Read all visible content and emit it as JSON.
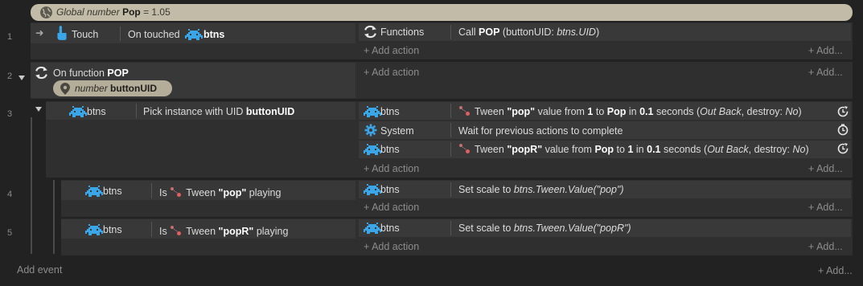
{
  "global_var": {
    "prefix": "Global number",
    "name": "Pop",
    "value_text": "= 1.05"
  },
  "rows": [
    {
      "num": "1",
      "cond_object": "Touch",
      "cond_text_pre": "On touched",
      "cond_obj2": "btns",
      "act_object": "Functions",
      "act_text_pre": "Call",
      "act_bold": "POP",
      "act_text_post": "(buttonUID:",
      "act_italic": "btns.UID",
      "act_close": ")",
      "add_action": "Add action",
      "add_more": "Add..."
    },
    {
      "num": "2",
      "cond_text_pre": "On function",
      "cond_bold": "POP",
      "param_italic": "number",
      "param_name": "buttonUID",
      "add_action": "Add action",
      "add_more": "Add..."
    },
    {
      "num": "3",
      "cond_object": "btns",
      "cond_text_pre": "Pick instance with UID",
      "cond_bold": "buttonUID",
      "actions": [
        {
          "object": "btns",
          "t1": "Tween",
          "b1": "\"pop\"",
          "t2": "value from",
          "b2": "1",
          "t3": "to",
          "b3": "Pop",
          "t4": "in",
          "b4": "0.1",
          "t5": "seconds (",
          "i1": "Out Back",
          "t6": ", destroy:",
          "i2": "No",
          "t7": ")"
        },
        {
          "object": "System",
          "text": "Wait for previous actions to complete"
        },
        {
          "object": "btns",
          "t1": "Tween",
          "b1": "\"popR\"",
          "t2": "value from",
          "b2": "Pop",
          "t3": "to",
          "b3": "1",
          "t4": "in",
          "b4": "0.1",
          "t5": "seconds (",
          "i1": "Out Back",
          "t6": ", destroy:",
          "i2": "No",
          "t7": ")"
        }
      ],
      "add_action": "Add action",
      "add_more": "Add..."
    },
    {
      "num": "4",
      "cond_object": "btns",
      "cond_text_pre": "Is",
      "cond_text_mid": "Tween",
      "cond_bold": "\"pop\"",
      "cond_text_post": "playing",
      "act_object": "btns",
      "act_text": "Set scale to",
      "act_italic": "btns.Tween.Value(\"pop\")",
      "add_action": "Add action",
      "add_more": "Add..."
    },
    {
      "num": "5",
      "cond_object": "btns",
      "cond_text_pre": "Is",
      "cond_text_mid": "Tween",
      "cond_bold": "\"popR\"",
      "cond_text_post": "playing",
      "act_object": "btns",
      "act_text": "Set scale to",
      "act_italic": "btns.Tween.Value(\"popR\")",
      "add_action": "Add action",
      "add_more": "Add..."
    }
  ],
  "footer": {
    "add_event": "Add event",
    "add_more": "Add..."
  },
  "icons": {
    "globe": "globe-icon",
    "touch": "hand-pointer-icon",
    "sprite": "invader-sprite-icon",
    "function": "swap-arrows-icon",
    "gear": "gear-icon",
    "tween": "tween-icon",
    "loop": "refresh-icon",
    "timer": "stopwatch-icon",
    "pin": "map-pin-icon"
  }
}
